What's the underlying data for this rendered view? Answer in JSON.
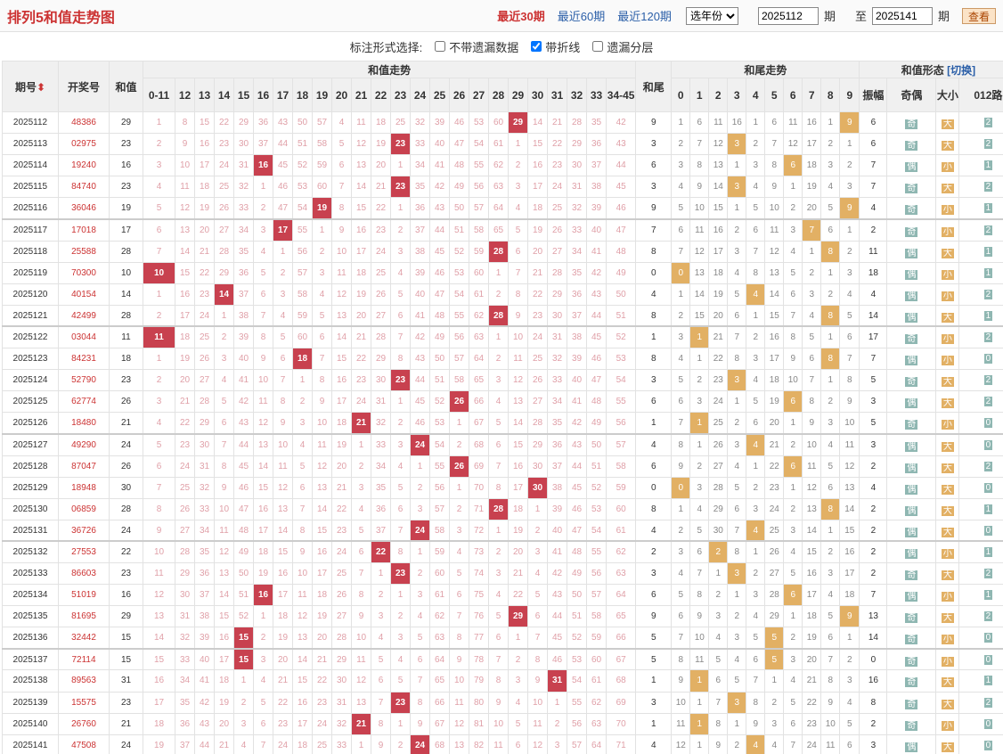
{
  "title": "排列5和值走势图",
  "links": [
    "最近30期",
    "最近60期",
    "最近120期"
  ],
  "year_select": "选年份",
  "from_period": "2025112",
  "to_period": "2025141",
  "label_qi": "期",
  "label_zhi": "至",
  "search_btn": "查看",
  "options": {
    "label": "标注形式选择:",
    "opt1": "不带遗漏数据",
    "opt2": "带折线",
    "opt3": "遗漏分层"
  },
  "headers": {
    "period": "期号",
    "number": "开奖号",
    "sum": "和值",
    "trend": "和值走势",
    "tail": "和尾",
    "tail_trend": "和尾走势",
    "shape": "和值形态",
    "switch": "[切换]",
    "span": "振幅",
    "oe": "奇偶",
    "bs": "大小",
    "r012": "012路"
  },
  "sum_cols": [
    "0-11",
    "12",
    "13",
    "14",
    "15",
    "16",
    "17",
    "18",
    "19",
    "20",
    "21",
    "22",
    "23",
    "24",
    "25",
    "26",
    "27",
    "28",
    "29",
    "30",
    "31",
    "32",
    "33",
    "34-45"
  ],
  "rows": [
    {
      "p": "2025112",
      "n": "48386",
      "s": "29",
      "t": "9",
      "span": "6",
      "oe": "奇",
      "bs": "大",
      "r": "2"
    },
    {
      "p": "2025113",
      "n": "02975",
      "s": "23",
      "t": "3",
      "span": "6",
      "oe": "奇",
      "bs": "大",
      "r": "2"
    },
    {
      "p": "2025114",
      "n": "19240",
      "s": "16",
      "t": "6",
      "span": "7",
      "oe": "偶",
      "bs": "小",
      "r": "1"
    },
    {
      "p": "2025115",
      "n": "84740",
      "s": "23",
      "t": "3",
      "span": "7",
      "oe": "奇",
      "bs": "大",
      "r": "2"
    },
    {
      "p": "2025116",
      "n": "36046",
      "s": "19",
      "t": "9",
      "span": "4",
      "oe": "奇",
      "bs": "小",
      "r": "1"
    },
    {
      "p": "2025117",
      "n": "17018",
      "s": "17",
      "t": "7",
      "span": "2",
      "oe": "奇",
      "bs": "小",
      "r": "2"
    },
    {
      "p": "2025118",
      "n": "25588",
      "s": "28",
      "t": "8",
      "span": "11",
      "oe": "偶",
      "bs": "大",
      "r": "1"
    },
    {
      "p": "2025119",
      "n": "70300",
      "s": "10",
      "t": "0",
      "span": "18",
      "oe": "偶",
      "bs": "小",
      "r": "1"
    },
    {
      "p": "2025120",
      "n": "40154",
      "s": "14",
      "t": "4",
      "span": "4",
      "oe": "偶",
      "bs": "小",
      "r": "2"
    },
    {
      "p": "2025121",
      "n": "42499",
      "s": "28",
      "t": "8",
      "span": "14",
      "oe": "偶",
      "bs": "大",
      "r": "1"
    },
    {
      "p": "2025122",
      "n": "03044",
      "s": "11",
      "t": "1",
      "span": "17",
      "oe": "奇",
      "bs": "小",
      "r": "2"
    },
    {
      "p": "2025123",
      "n": "84231",
      "s": "18",
      "t": "8",
      "span": "7",
      "oe": "偶",
      "bs": "小",
      "r": "0"
    },
    {
      "p": "2025124",
      "n": "52790",
      "s": "23",
      "t": "3",
      "span": "5",
      "oe": "奇",
      "bs": "大",
      "r": "2"
    },
    {
      "p": "2025125",
      "n": "62774",
      "s": "26",
      "t": "6",
      "span": "3",
      "oe": "偶",
      "bs": "大",
      "r": "2"
    },
    {
      "p": "2025126",
      "n": "18480",
      "s": "21",
      "t": "1",
      "span": "5",
      "oe": "奇",
      "bs": "小",
      "r": "0"
    },
    {
      "p": "2025127",
      "n": "49290",
      "s": "24",
      "t": "4",
      "span": "3",
      "oe": "偶",
      "bs": "大",
      "r": "0"
    },
    {
      "p": "2025128",
      "n": "87047",
      "s": "26",
      "t": "6",
      "span": "2",
      "oe": "偶",
      "bs": "大",
      "r": "2"
    },
    {
      "p": "2025129",
      "n": "18948",
      "s": "30",
      "t": "0",
      "span": "4",
      "oe": "偶",
      "bs": "大",
      "r": "0"
    },
    {
      "p": "2025130",
      "n": "06859",
      "s": "28",
      "t": "8",
      "span": "2",
      "oe": "偶",
      "bs": "大",
      "r": "1"
    },
    {
      "p": "2025131",
      "n": "36726",
      "s": "24",
      "t": "4",
      "span": "2",
      "oe": "偶",
      "bs": "大",
      "r": "0"
    },
    {
      "p": "2025132",
      "n": "27553",
      "s": "22",
      "t": "2",
      "span": "2",
      "oe": "偶",
      "bs": "小",
      "r": "1"
    },
    {
      "p": "2025133",
      "n": "86603",
      "s": "23",
      "t": "3",
      "span": "2",
      "oe": "奇",
      "bs": "大",
      "r": "2"
    },
    {
      "p": "2025134",
      "n": "51019",
      "s": "16",
      "t": "6",
      "span": "7",
      "oe": "偶",
      "bs": "小",
      "r": "1"
    },
    {
      "p": "2025135",
      "n": "81695",
      "s": "29",
      "t": "9",
      "span": "13",
      "oe": "奇",
      "bs": "大",
      "r": "2"
    },
    {
      "p": "2025136",
      "n": "32442",
      "s": "15",
      "t": "5",
      "span": "14",
      "oe": "奇",
      "bs": "小",
      "r": "0"
    },
    {
      "p": "2025137",
      "n": "72114",
      "s": "15",
      "t": "5",
      "span": "0",
      "oe": "奇",
      "bs": "小",
      "r": "0"
    },
    {
      "p": "2025138",
      "n": "89563",
      "s": "31",
      "t": "1",
      "span": "16",
      "oe": "奇",
      "bs": "大",
      "r": "1"
    },
    {
      "p": "2025139",
      "n": "15575",
      "s": "23",
      "t": "3",
      "span": "8",
      "oe": "奇",
      "bs": "大",
      "r": "2"
    },
    {
      "p": "2025140",
      "n": "26760",
      "s": "21",
      "t": "1",
      "span": "2",
      "oe": "奇",
      "bs": "小",
      "r": "0"
    },
    {
      "p": "2025141",
      "n": "47508",
      "s": "24",
      "t": "4",
      "span": "3",
      "oe": "偶",
      "bs": "大",
      "r": "0"
    }
  ]
}
